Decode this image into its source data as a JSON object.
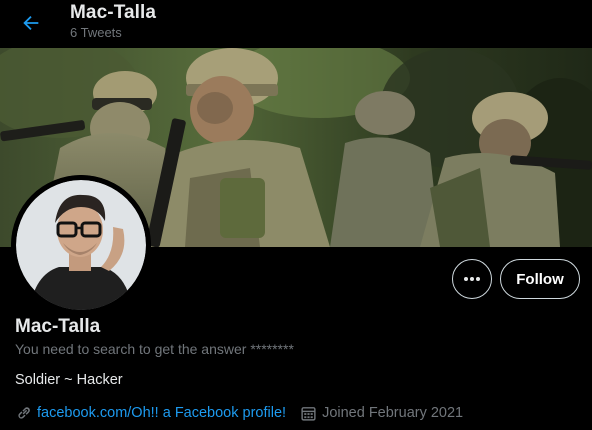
{
  "header": {
    "name": "Mac-Talla",
    "tweet_count": "6 Tweets",
    "back_icon": "arrow-left-icon"
  },
  "profile": {
    "display_name": "Mac-Talla",
    "handle_line": "You need to search to get the answer ********",
    "bio": "Soldier ~ Hacker",
    "link_text": "facebook.com/Oh!! a Facebook profile!",
    "joined_text": "Joined February 2021"
  },
  "actions": {
    "more_icon": "more-dots-icon",
    "follow_label": "Follow"
  },
  "colors": {
    "background": "#000000",
    "accent": "#1d9bf0",
    "muted": "#71767b",
    "text": "#e7e9ea"
  }
}
